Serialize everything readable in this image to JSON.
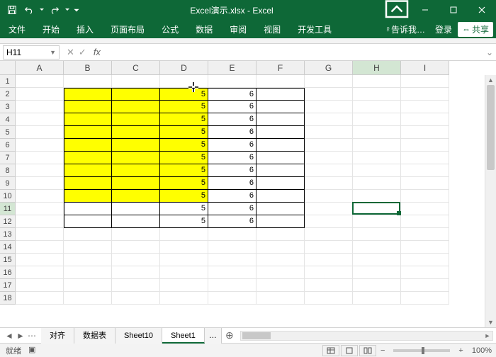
{
  "title": "Excel演示.xlsx - Excel",
  "menu": {
    "file": "文件",
    "home": "开始",
    "insert": "插入",
    "layout": "页面布局",
    "formulas": "公式",
    "data": "数据",
    "review": "审阅",
    "view": "视图",
    "dev": "开发工具",
    "tellme": "告诉我…",
    "signin": "登录",
    "share": "共享"
  },
  "name_box": "H11",
  "columns": [
    "A",
    "B",
    "C",
    "D",
    "E",
    "F",
    "G",
    "H",
    "I"
  ],
  "rows": [
    1,
    2,
    3,
    4,
    5,
    6,
    7,
    8,
    9,
    10,
    11,
    12,
    13,
    14,
    15,
    16,
    17,
    18
  ],
  "cells": {
    "D": {
      "2": "5",
      "3": "5",
      "4": "5",
      "5": "5",
      "6": "5",
      "7": "5",
      "8": "5",
      "9": "5",
      "10": "5",
      "11": "5",
      "12": "5"
    },
    "E": {
      "2": "6",
      "3": "6",
      "4": "6",
      "5": "6",
      "6": "6",
      "7": "6",
      "8": "6",
      "9": "6",
      "10": "6",
      "11": "6",
      "12": "6"
    }
  },
  "yellow_region": {
    "rows": [
      2,
      3,
      4,
      5,
      6,
      7,
      8,
      9,
      10
    ],
    "cols": [
      "B",
      "C",
      "D"
    ]
  },
  "table_border": {
    "rows": [
      2,
      3,
      4,
      5,
      6,
      7,
      8,
      9,
      10,
      11,
      12
    ],
    "cols": [
      "B",
      "C",
      "D",
      "E",
      "F"
    ]
  },
  "active": {
    "col": "H",
    "row": 11
  },
  "tabs": {
    "items": [
      "对齐",
      "数据表",
      "Sheet10",
      "Sheet1"
    ],
    "active": "Sheet1",
    "more": "…"
  },
  "status": {
    "ready": "就绪",
    "rec": "",
    "zoom": "100%"
  },
  "icons": {
    "plus": "+",
    "minus": "−",
    "dots": "⋯"
  }
}
